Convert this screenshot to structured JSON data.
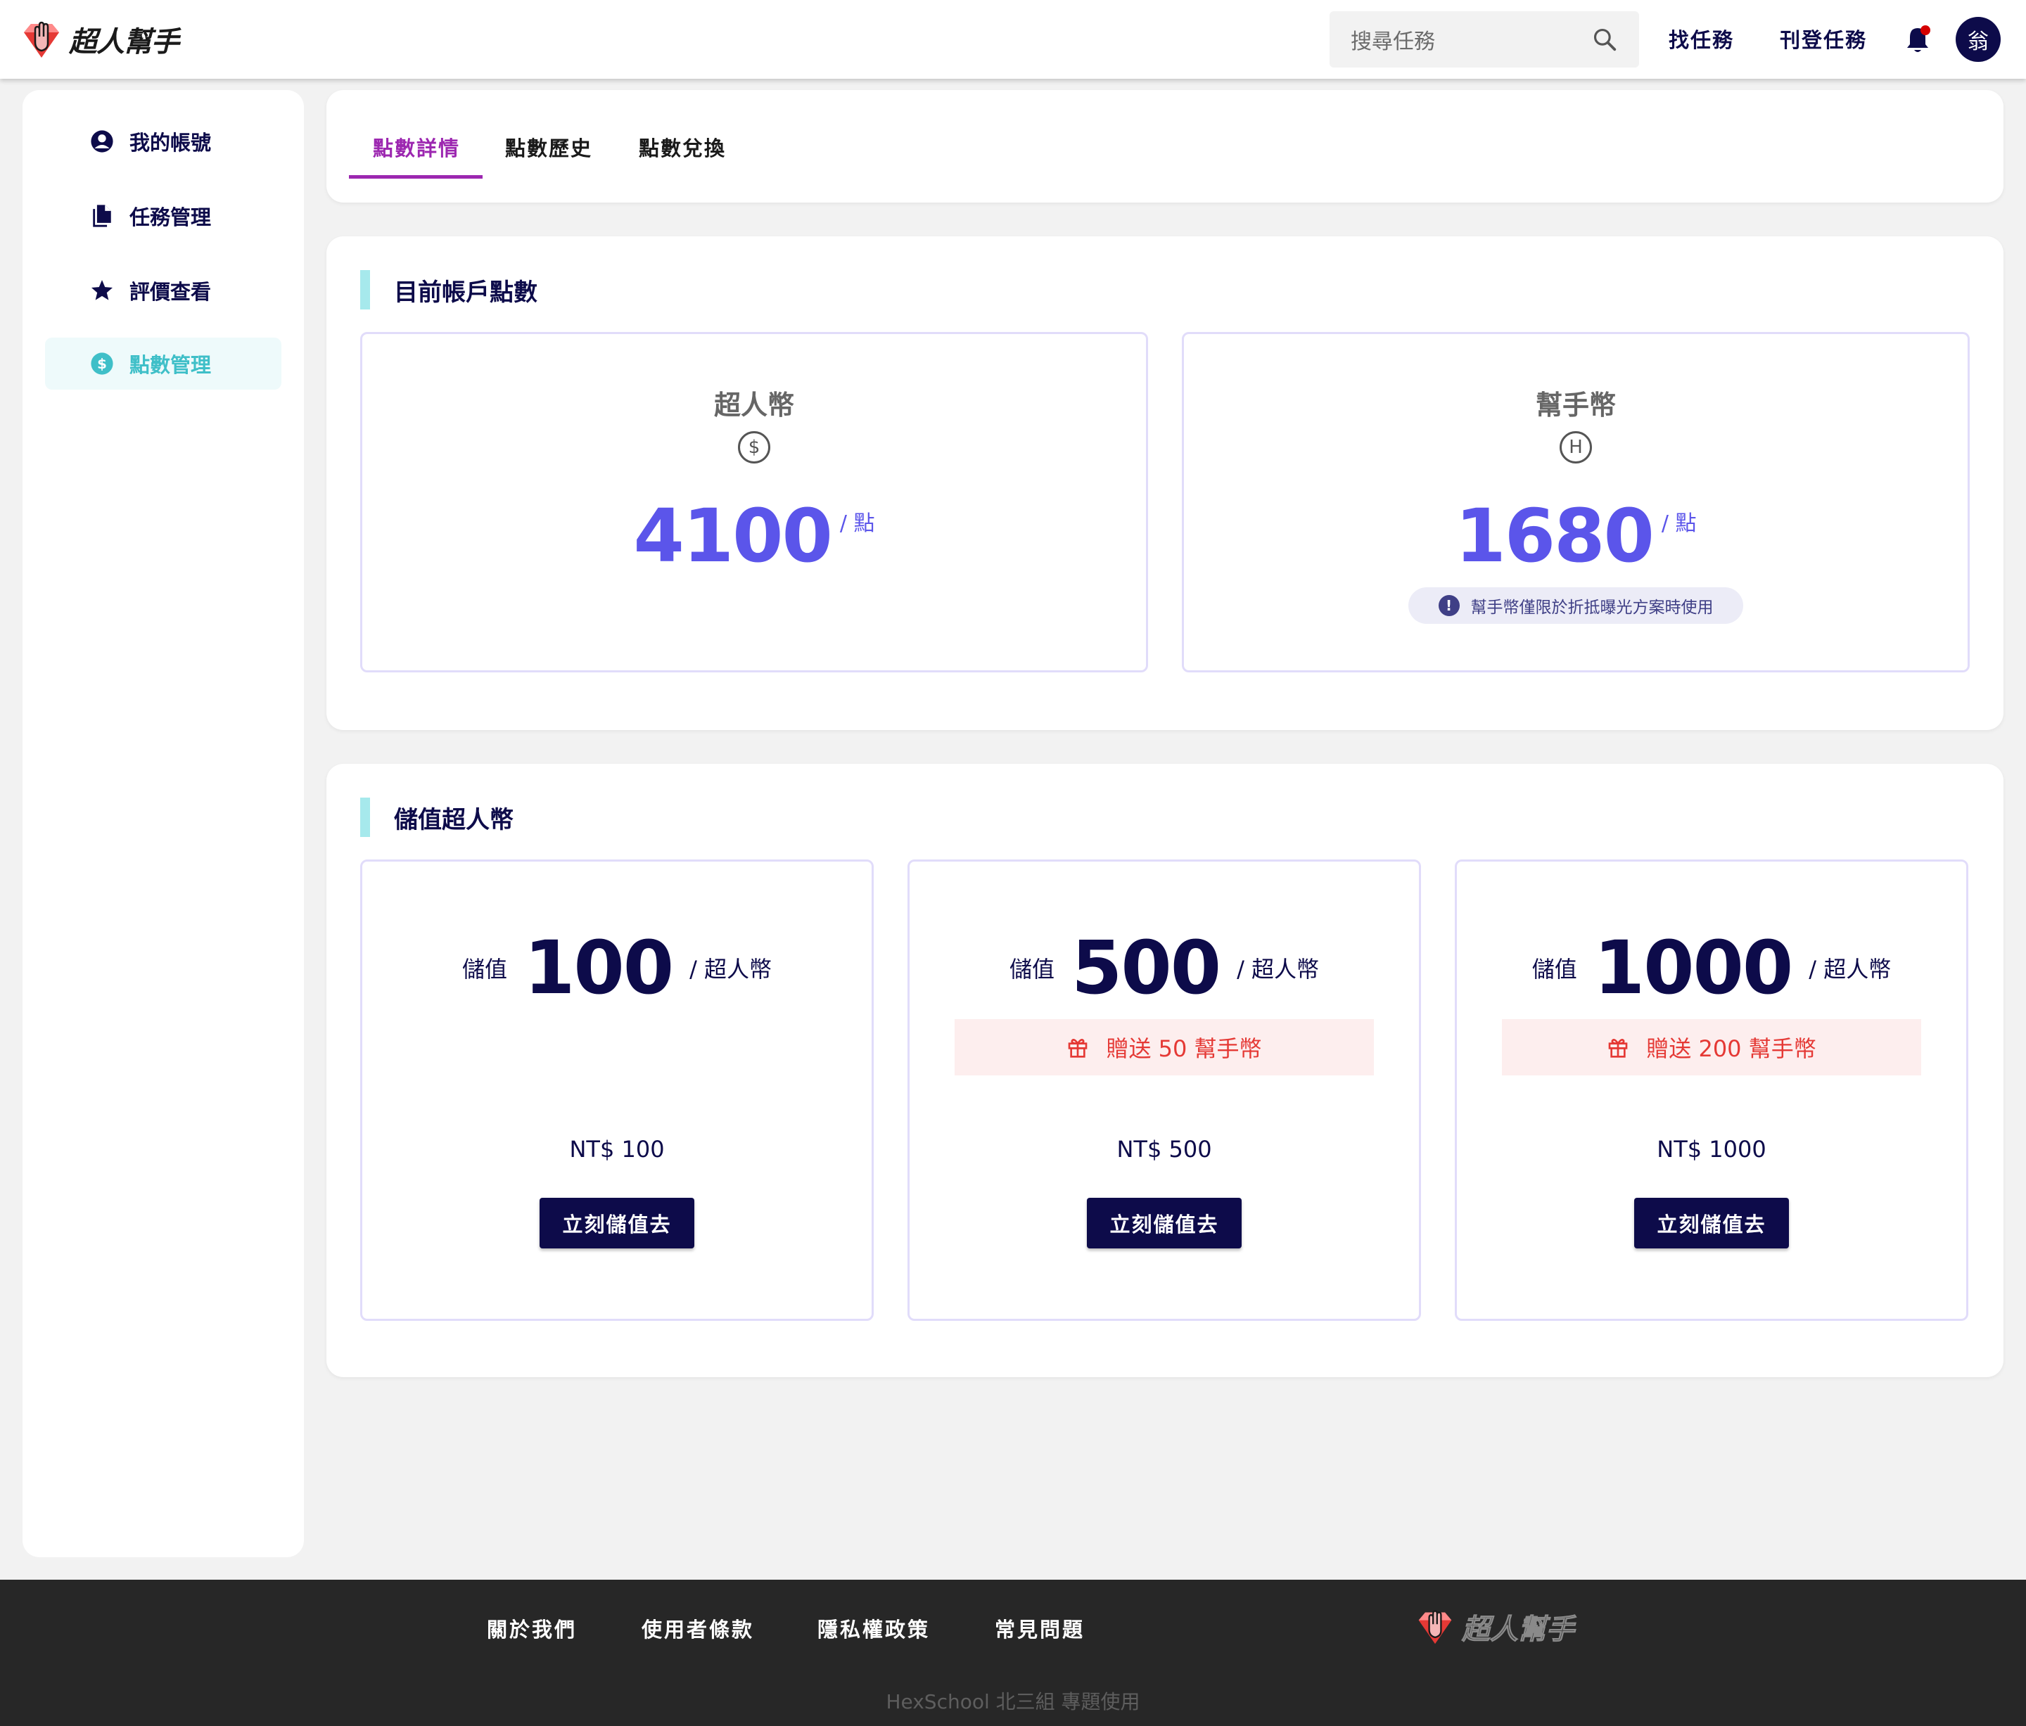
{
  "header": {
    "brand": "超人幫手",
    "search_placeholder": "搜尋任務",
    "nav": [
      "找任務",
      "刊登任務"
    ],
    "avatar_initial": "翁"
  },
  "sidebar": {
    "items": [
      {
        "label": "我的帳號",
        "icon": "user-circle-icon"
      },
      {
        "label": "任務管理",
        "icon": "documents-icon"
      },
      {
        "label": "評價查看",
        "icon": "star-icon"
      },
      {
        "label": "點數管理",
        "icon": "dollar-circle-icon",
        "active": true
      }
    ]
  },
  "tabs": [
    {
      "label": "點數詳情",
      "active": true
    },
    {
      "label": "點數歷史"
    },
    {
      "label": "點數兌換"
    }
  ],
  "balance": {
    "title": "目前帳戶點數",
    "coins": [
      {
        "name": "超人幣",
        "symbol": "$",
        "value": "4100",
        "unit": "/ 點"
      },
      {
        "name": "幫手幣",
        "symbol": "H",
        "value": "1680",
        "unit": "/ 點",
        "note": "幫手幣僅限於折抵曝光方案時使用"
      }
    ]
  },
  "topup": {
    "title": "儲值超人幣",
    "plans": [
      {
        "prefix": "儲值",
        "amount": "100",
        "suffix": "/ 超人幣",
        "bonus": "",
        "price": "NT$ 100",
        "button": "立刻儲值去"
      },
      {
        "prefix": "儲值",
        "amount": "500",
        "suffix": "/ 超人幣",
        "bonus": "贈送 50 幫手幣",
        "price": "NT$ 500",
        "button": "立刻儲值去"
      },
      {
        "prefix": "儲值",
        "amount": "1000",
        "suffix": "/ 超人幣",
        "bonus": "贈送 200 幫手幣",
        "price": "NT$ 1000",
        "button": "立刻儲值去"
      }
    ]
  },
  "footer": {
    "links": [
      "關於我們",
      "使用者條款",
      "隱私權政策",
      "常見問題"
    ],
    "brand": "超人幫手",
    "copyright": "HexSchool 北三組 專題使用"
  },
  "colors": {
    "navy": "#0d0b4a",
    "accent_purple": "#9c27b0",
    "coin_blue": "#5b55ea",
    "teal": "#3fbfc8",
    "bonus_red": "#e53935"
  }
}
